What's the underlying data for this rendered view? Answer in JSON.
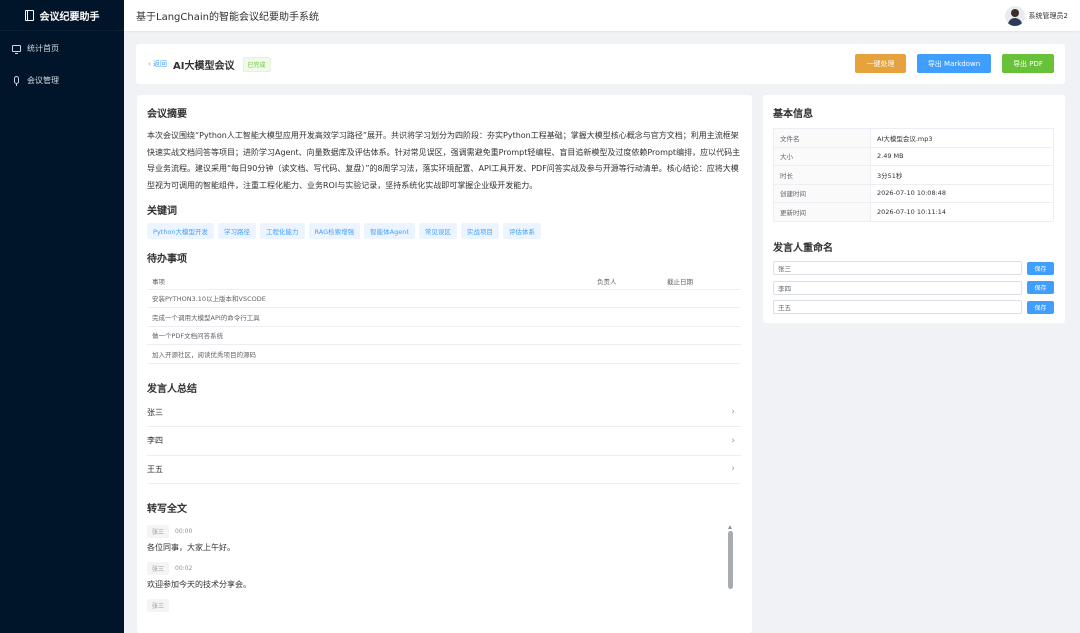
{
  "app": {
    "brand": "会议纪要助手",
    "header_title": "基于LangChain的智能会议纪要助手系统",
    "user_name": "系统管理员2"
  },
  "sidebar": {
    "items": [
      {
        "label": "统计首页",
        "icon": "monitor-icon"
      },
      {
        "label": "会议管理",
        "icon": "microphone-icon"
      }
    ]
  },
  "titlebar": {
    "back": "‹ 返回",
    "title": "AI大模型会议",
    "status": "已完成",
    "actions": {
      "process": "一键处理",
      "export_md": "导出 Markdown",
      "export_pdf": "导出 PDF"
    }
  },
  "summary": {
    "heading": "会议摘要",
    "text": "本次会议围绕“Python人工智能大模型应用开发高效学习路径”展开。共识将学习划分为四阶段：夯实Python工程基础；掌握大模型核心概念与官方文档；利用主流框架快速实战文档问答等项目；进阶学习Agent、向量数据库及评估体系。针对常见误区，强调需避免重Prompt轻编程、盲目追新模型及过度依赖Prompt编排，应以代码主导业务流程。建议采用“每日90分钟（读文档、写代码、复盘）”的8周学习法，落实环境配置、API工具开发、PDF问答实战及参与开源等行动清单。核心结论：应将大模型视为可调用的智能组件，注重工程化能力、业务ROI与实验记录，坚持系统化实战即可掌握企业级开发能力。"
  },
  "keywords": {
    "heading": "关键词",
    "items": [
      "Python大模型开发",
      "学习路径",
      "工程化能力",
      "RAG检索增强",
      "智能体Agent",
      "常见误区",
      "实战项目",
      "评估体系"
    ]
  },
  "todos": {
    "heading": "待办事项",
    "columns": [
      "事项",
      "负责人",
      "截止日期"
    ],
    "rows": [
      [
        "安装PYTHON3.10以上版本和VSCODE",
        "",
        ""
      ],
      [
        "完成一个调用大模型API的命令行工具",
        "",
        ""
      ],
      [
        "做一个PDF文档问答系统",
        "",
        ""
      ],
      [
        "加入开源社区，阅读优秀项目的源码",
        "",
        ""
      ]
    ]
  },
  "speaker_summary": {
    "heading": "发言人总结",
    "items": [
      "张三",
      "李四",
      "王五"
    ]
  },
  "transcript": {
    "heading": "转写全文",
    "lines": [
      {
        "speaker": "张三",
        "time": "00:00",
        "text": "各位同事，大家上午好。"
      },
      {
        "speaker": "张三",
        "time": "00:02",
        "text": "欢迎参加今天的技术分享会。"
      }
    ]
  },
  "basic_info": {
    "heading": "基本信息",
    "rows": [
      {
        "key": "文件名",
        "value": "AI大模型会议.mp3"
      },
      {
        "key": "大小",
        "value": "2.49 MB"
      },
      {
        "key": "时长",
        "value": "3分51秒"
      },
      {
        "key": "创建时间",
        "value": "2026-07-10 10:08:48"
      },
      {
        "key": "更新时间",
        "value": "2026-07-10 10:11:14"
      }
    ]
  },
  "rename": {
    "heading": "发言人重命名",
    "save_label": "保存",
    "speakers": [
      "张三",
      "李四",
      "王五"
    ]
  },
  "colors": {
    "sidebar_bg": "#001529",
    "primary": "#409eff",
    "success": "#67c23a",
    "warning": "#e6a23c"
  }
}
